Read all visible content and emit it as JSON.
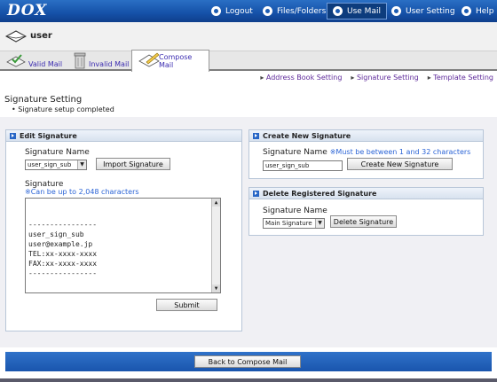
{
  "app": {
    "logo": "DOX"
  },
  "topnav": [
    {
      "label": "Logout",
      "icon": "logout-icon"
    },
    {
      "label": "Files/Folders",
      "icon": "folder-icon"
    },
    {
      "label": "Use Mail",
      "icon": "mail-icon"
    },
    {
      "label": "User Setting",
      "icon": "user-icon"
    },
    {
      "label": "Help",
      "icon": "help-icon"
    }
  ],
  "user": {
    "name": "user"
  },
  "tabs": [
    {
      "label": "Valid Mail"
    },
    {
      "label": "Invalid Mail"
    },
    {
      "label": "Compose Mail"
    }
  ],
  "sublinks": [
    "Address Book Setting",
    "Signature Setting",
    "Template Setting"
  ],
  "page": {
    "title": "Signature Setting",
    "status": "Signature setup completed"
  },
  "edit": {
    "header": "Edit Signature",
    "name_label": "Signature Name",
    "selected": "user_sign_sub",
    "import_button": "Import Signature",
    "sig_label": "Signature",
    "sig_note": "※Can be up to 2,048 characters",
    "sig_text": "----------------\nuser_sign_sub\nuser@example.jp\nTEL:xx-xxxx-xxxx\nFAX:xx-xxxx-xxxx\n----------------",
    "submit_button": "Submit"
  },
  "create": {
    "header": "Create New Signature",
    "name_label": "Signature Name",
    "name_note": "※Must be between 1 and 32 characters",
    "input_value": "user_sign_sub",
    "create_button": "Create New Signature"
  },
  "delete": {
    "header": "Delete Registered Signature",
    "name_label": "Signature Name",
    "selected": "Main Signature",
    "delete_button": "Delete Signature"
  },
  "footer": {
    "back_button": "Back to Compose Mail"
  }
}
